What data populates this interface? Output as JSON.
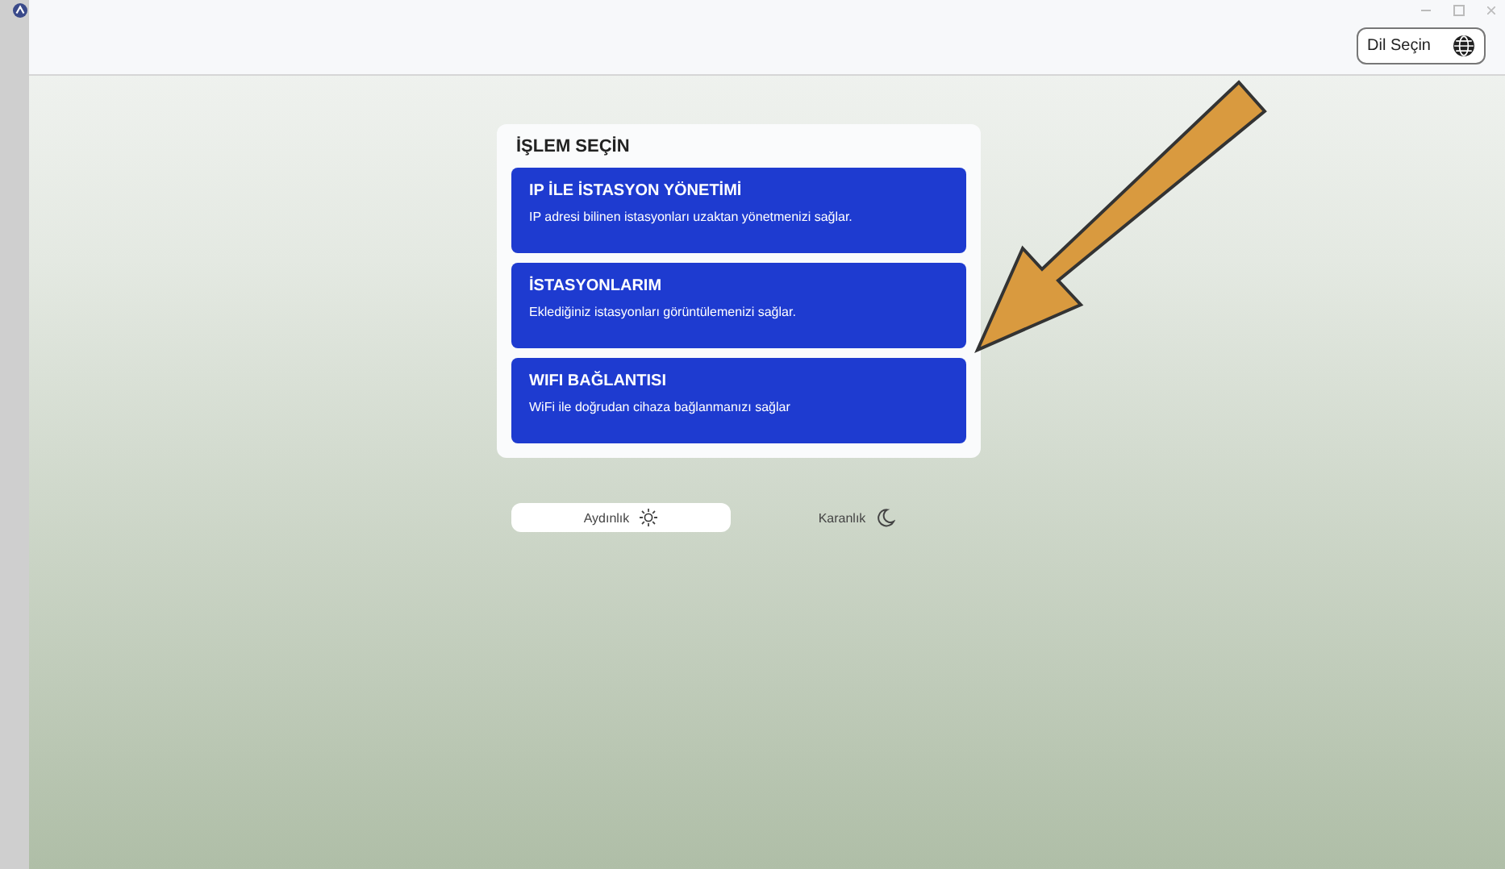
{
  "header": {
    "language_button": "Dil Seçin"
  },
  "panel": {
    "title": "İŞLEM SEÇİN",
    "options": [
      {
        "title": "IP İLE İSTASYON YÖNETİMİ",
        "description": "IP adresi bilinen istasyonları uzaktan yönetmenizi sağlar."
      },
      {
        "title": "İSTASYONLARIM",
        "description": "Eklediğiniz istasyonları görüntülemenizi sağlar."
      },
      {
        "title": "WIFI BAĞLANTISI",
        "description": "WiFi ile doğrudan cihaza bağlanmanızı sağlar"
      }
    ]
  },
  "theme_toggle": [
    {
      "label": "Aydınlık",
      "kind": "light",
      "selected": true
    },
    {
      "label": "Karanlık",
      "kind": "dark",
      "selected": false
    }
  ]
}
